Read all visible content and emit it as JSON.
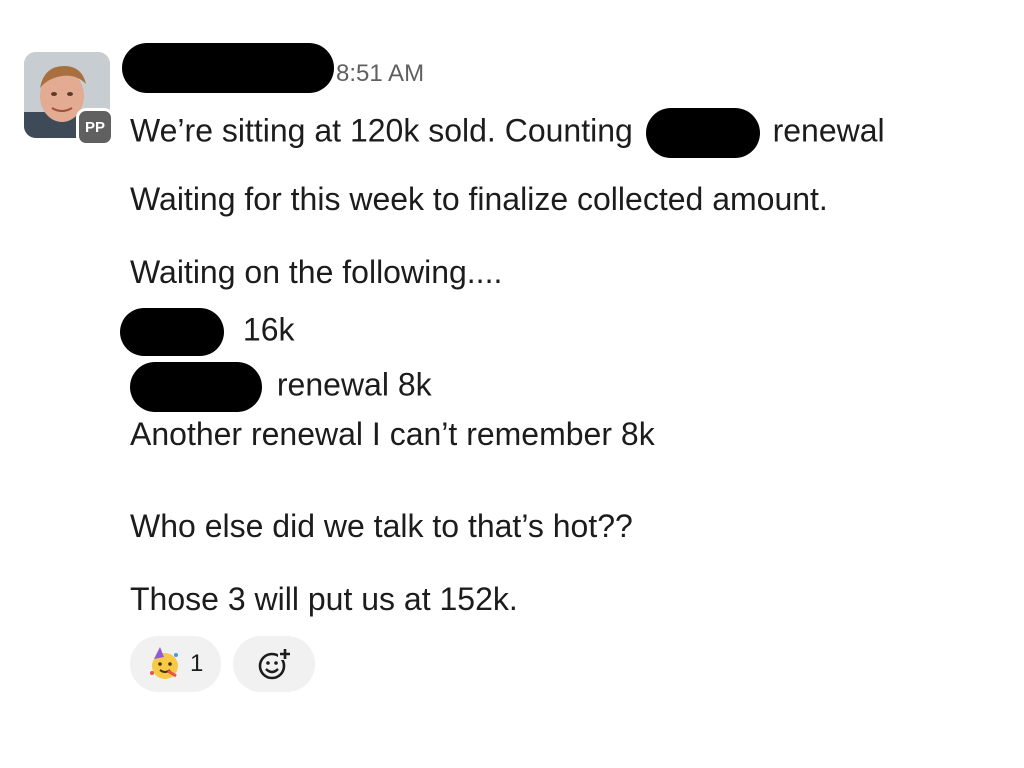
{
  "message": {
    "avatar_badge": "PP",
    "timestamp": "8:51 AM",
    "lines": {
      "line1_before": "We’re sitting at 120k sold. Counting",
      "line1_after": "renewal",
      "line2": "Waiting for this week to finalize collected amount.",
      "line3": "Waiting on the following....",
      "line4_after": "16k",
      "line5_after": "renewal 8k",
      "line6": "Another renewal I can’t remember 8k",
      "line7": "Who else did we talk to that’s hot??",
      "line8": "Those 3 will put us at 152k."
    }
  },
  "reactions": {
    "party": {
      "icon": "party-face-icon",
      "count": "1"
    },
    "add": {
      "icon": "add-reaction-icon"
    }
  }
}
